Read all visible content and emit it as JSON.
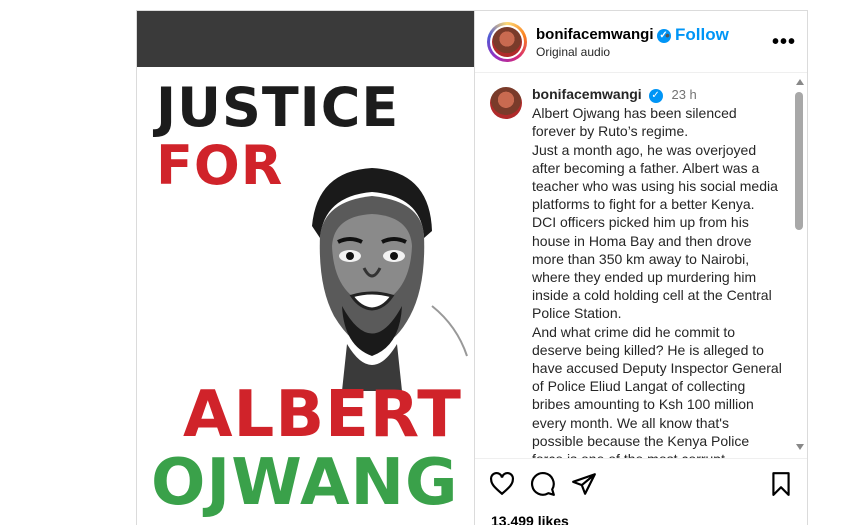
{
  "post": {
    "media": {
      "poster_lines": [
        "JUSTICE",
        "FOR",
        "ALBERT",
        "OJWANG"
      ],
      "colors": {
        "dark": "#1c1c1c",
        "red": "#d0232a",
        "green": "#3aa14a",
        "top_bar": "#3a3a3a"
      }
    },
    "header": {
      "username": "bonifacemwangi",
      "dot": "•",
      "follow_label": "Follow",
      "audio": "Original audio",
      "more_icon": "more-horizontal-icon"
    },
    "comment": {
      "username": "bonifacemwangi",
      "time": "23 h",
      "paragraphs": [
        "Albert Ojwang has been silenced forever by Ruto’s regime.",
        "Just a month ago, he was overjoyed after becoming a father. Albert was a teacher who was using his social media platforms to fight for a better Kenya. DCI officers picked him up from his house in Homa Bay and then drove more than 350 km away to Nairobi, where they ended up murdering him inside a cold holding cell at the Central Police Station.",
        "And what crime did he commit to deserve being killed? He is alleged to have accused Deputy Inspector General of Police Eliud Langat of collecting bribes amounting to Ksh 100 million every month. We all know that's possible because the Kenya Police force is one of the most corrupt"
      ]
    },
    "actions": {
      "icons": [
        "heart-icon",
        "comment-icon",
        "share-icon",
        "save-icon"
      ],
      "likes": "13,499 likes"
    },
    "accent_color": "#0095f6"
  }
}
